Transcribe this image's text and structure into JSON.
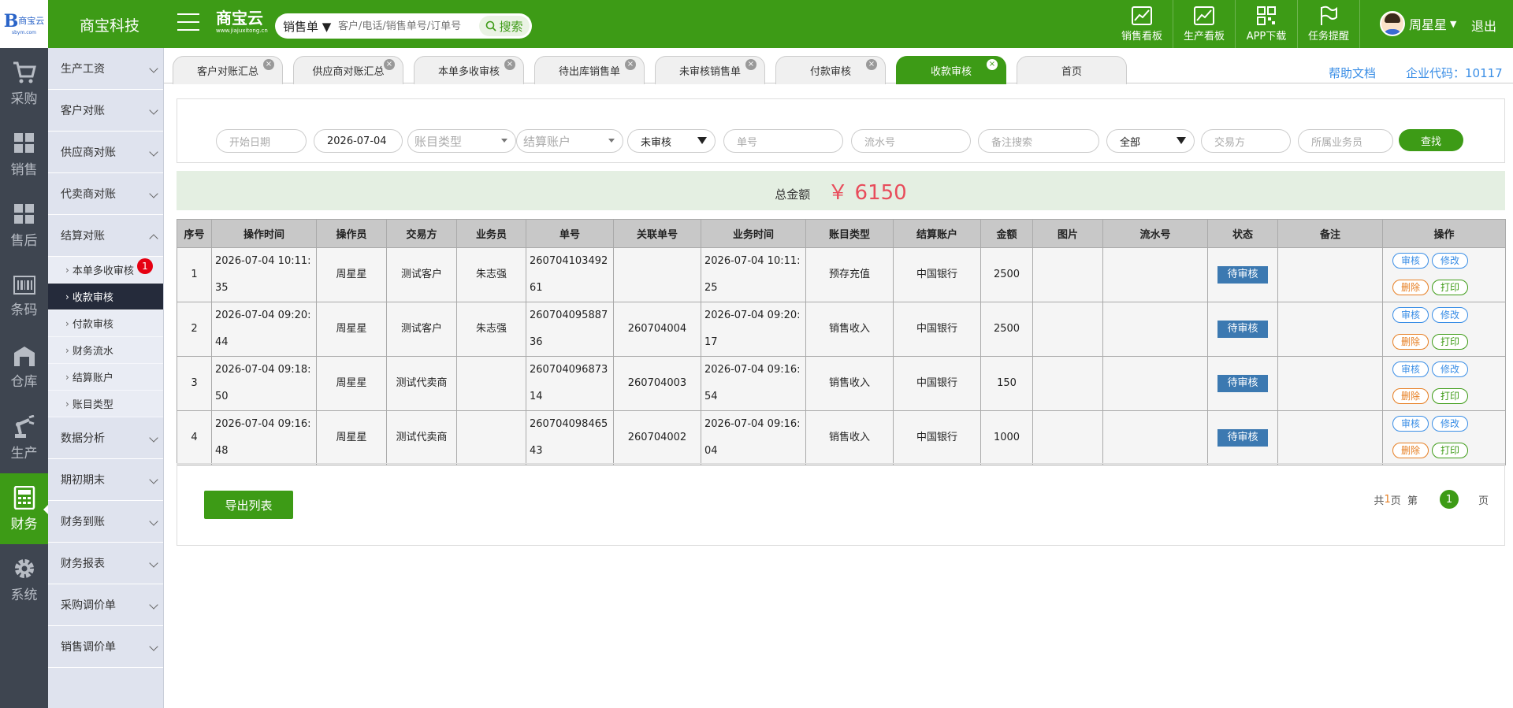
{
  "header": {
    "logo_text": "商宝云",
    "logo_sub": "sbym.com",
    "company": "商宝科技",
    "brand": "商宝云",
    "brand_sub": "www.jiajuxitong.cn",
    "search_type": "销售单 ▼",
    "search_placeholder": "客户/电话/销售单号/订单号",
    "search_button": "搜索",
    "tools": [
      {
        "label": "销售看板",
        "icon": "chart-line-icon"
      },
      {
        "label": "生产看板",
        "icon": "chart-line-icon"
      },
      {
        "label": "APP下载",
        "icon": "qr-code-icon"
      },
      {
        "label": "任务提醒",
        "icon": "flag-icon"
      }
    ],
    "user_name": "周星星",
    "logout": "退出"
  },
  "rail": [
    {
      "label": "采购",
      "icon": "cart-icon"
    },
    {
      "label": "销售",
      "icon": "grid-icon"
    },
    {
      "label": "售后",
      "icon": "grid-icon"
    },
    {
      "label": "条码",
      "icon": "barcode-icon"
    },
    {
      "label": "仓库",
      "icon": "warehouse-icon"
    },
    {
      "label": "生产",
      "icon": "robot-arm-icon"
    },
    {
      "label": "财务",
      "icon": "calculator-icon"
    },
    {
      "label": "系统",
      "icon": "gear-icon"
    }
  ],
  "submenu": {
    "groups": [
      "生产工资",
      "客户对账",
      "供应商对账",
      "代卖商对账",
      "结算对账",
      "数据分析",
      "期初期末",
      "财务到账",
      "财务报表",
      "采购调价单",
      "销售调价单"
    ],
    "subitems": [
      "本单多收审核",
      "收款审核",
      "付款审核",
      "财务流水",
      "结算账户",
      "账目类型"
    ],
    "badge": "1"
  },
  "tabs": [
    "客户对账汇总",
    "供应商对账汇总",
    "本单多收审核",
    "待出库销售单",
    "未审核销售单",
    "付款审核",
    "收款审核",
    "首页"
  ],
  "tab_close": "×",
  "top_links": {
    "help": "帮助文档",
    "corp": "企业代码：10117"
  },
  "filters": {
    "start_date": "开始日期",
    "end_date": "2026-07-04",
    "account_type": "账目类型",
    "settle_account": "结算账户",
    "audit_status": "未审核",
    "order_no": "单号",
    "serial_no": "流水号",
    "remark": "备注搜索",
    "all": "全部",
    "counterparty": "交易方",
    "salesman": "所属业务员",
    "find": "查找"
  },
  "summary": {
    "label": "总金额",
    "value": "￥ 6150"
  },
  "table": {
    "headers": [
      "序号",
      "操作时间",
      "操作员",
      "交易方",
      "业务员",
      "单号",
      "关联单号",
      "业务时间",
      "账目类型",
      "结算账户",
      "金额",
      "图片",
      "流水号",
      "状态",
      "备注",
      "操作"
    ],
    "rows": [
      [
        "1",
        "2026-07-04 10:11:35",
        "周星星",
        "测试客户",
        "朱志强",
        "26070410349261",
        "",
        "2026-07-04 10:11:25",
        "预存充值",
        "中国银行",
        "2500",
        "",
        "",
        "待审核",
        ""
      ],
      [
        "2",
        "2026-07-04 09:20:44",
        "周星星",
        "测试客户",
        "朱志强",
        "26070409588736",
        "260704004",
        "2026-07-04 09:20:17",
        "销售收入",
        "中国银行",
        "2500",
        "",
        "",
        "待审核",
        ""
      ],
      [
        "3",
        "2026-07-04 09:18:50",
        "周星星",
        "测试代卖商",
        "",
        "26070409687314",
        "260704003",
        "2026-07-04 09:16:54",
        "销售收入",
        "中国银行",
        "150",
        "",
        "",
        "待审核",
        ""
      ],
      [
        "4",
        "2026-07-04 09:16:48",
        "周星星",
        "测试代卖商",
        "",
        "26070409846543",
        "260704002",
        "2026-07-04 09:16:04",
        "销售收入",
        "中国银行",
        "1000",
        "",
        "",
        "待审核",
        ""
      ]
    ],
    "ops": {
      "audit": "审核",
      "edit": "修改",
      "delete": "删除",
      "print": "打印"
    }
  },
  "bottom": {
    "export": "导出列表",
    "pager_prefix": "共",
    "pager_total": "1",
    "pager_mid": "页  第",
    "pager_current": "1",
    "pager_suffix": "页"
  },
  "colors": {
    "primary": "#3d9b16",
    "rail": "#3e4550",
    "submenu": "#dfe3ee",
    "link": "#3a8ee6",
    "amount": "#e84c5b"
  }
}
